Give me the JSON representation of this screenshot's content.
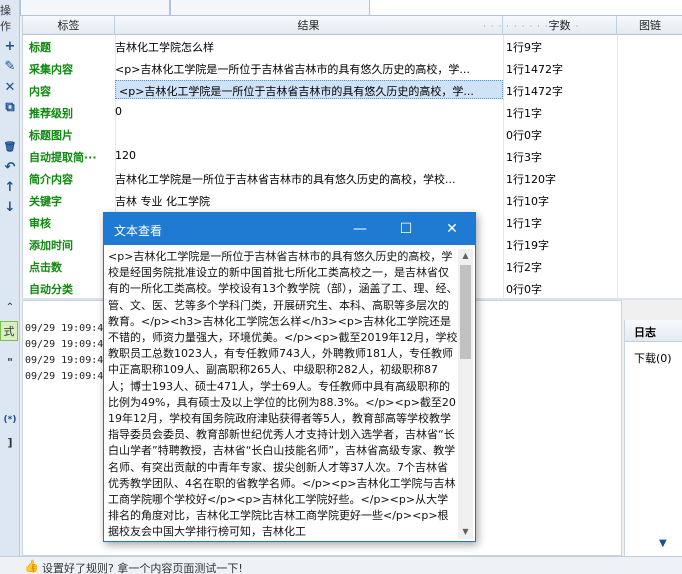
{
  "left_bar": {
    "label_top": "操作",
    "tools": [
      {
        "glyph": "+",
        "icon": "add-icon"
      },
      {
        "glyph": "✎",
        "icon": "edit-icon"
      },
      {
        "glyph": "✕",
        "icon": "delete-icon"
      },
      {
        "glyph": "⧉",
        "icon": "copy-icon"
      },
      {
        "glyph": "🗑",
        "icon": "trash-icon"
      },
      {
        "glyph": "↶",
        "icon": "undo-icon"
      },
      {
        "glyph": "↑",
        "icon": "move-up-icon"
      },
      {
        "glyph": "↓",
        "icon": "move-down-icon"
      }
    ],
    "collapse_glyph": "⌃",
    "tab_test": "式",
    "quote_glyph": "\"",
    "paren_glyph": "(*)",
    "bracket_glyph": "]"
  },
  "grid": {
    "columns": {
      "label": "标签",
      "result": "结果",
      "count": "字数",
      "link": "图链"
    },
    "more_glyph": "· · · · · · · · · · · · ·",
    "rows": [
      {
        "label": "标题",
        "result": "吉林化工学院怎么样",
        "count": "1行9字"
      },
      {
        "label": "采集内容",
        "result": "<p>吉林化工学院是一所位于吉林省吉林市的具有悠久历史的高校，学...",
        "count": "1行1472字"
      },
      {
        "label": "内容",
        "result": "<p>吉林化工学院是一所位于吉林省吉林市的具有悠久历史的高校，学...",
        "count": "1行1472字",
        "selected": true
      },
      {
        "label": "推荐级别",
        "result": "0",
        "count": "1行1字"
      },
      {
        "label": "标题图片",
        "result": "",
        "count": "0行0字"
      },
      {
        "label": "自动提取简···",
        "result": "120",
        "count": "1行3字"
      },
      {
        "label": "简介内容",
        "result": "吉林化工学院是一所位于吉林省吉林市的具有悠久历史的高校，学校...",
        "count": "1行120字"
      },
      {
        "label": "关键字",
        "result": "吉林  专业  化工学院",
        "count": "1行10字"
      },
      {
        "label": "审核",
        "result": "",
        "count": "1行1字"
      },
      {
        "label": "添加时间",
        "result": "",
        "count": "1行19字"
      },
      {
        "label": "点击数",
        "result": "",
        "count": "1行2字"
      },
      {
        "label": "自动分类",
        "result": "",
        "count": "0行0字"
      }
    ]
  },
  "log": {
    "lines": [
      "09/29 19:09:4",
      "09/29 19:09:4",
      "09/29 19:09:4",
      "09/29 19:09:4"
    ]
  },
  "right_panel": {
    "header": "日志",
    "item": "下载(0)",
    "arrow": "▼"
  },
  "status": {
    "text": "设置好了规则? 拿一个内容页面测试一下!"
  },
  "dialog": {
    "title": "文本查看",
    "minimize": "—",
    "maximize": "☐",
    "close": "✕",
    "text": "<p>吉林化工学院是一所位于吉林省吉林市的具有悠久历史的高校，学校是经国务院批准设立的新中国首批七所化工类高校之一，是吉林省仅有的一所化工类高校。学校设有13个教学院（部），涵盖了工、理、经、管、文、医、艺等多个学科门类，开展研究生、本科、高职等多层次的教育。</p><h3>吉林化工学院怎么样</h3><p>吉林化工学院还是不错的，师资力量强大，环境优美。</p><p>截至2019年12月，学校教职员工总数1023人，有专任教师743人，外聘教师181人，专任教师中正高职称109人、副高职称265人、中级职称282人，初级职称87人；博士193人、硕士471人，学士69人。专任教师中具有高级职称的比例为49%，具有硕士及以上学位的比例为88.3%。</p><p>截至2019年12月，学校有国务院政府津贴获得者等5人，教育部高等学校教学指导委员会委员、教育部新世纪优秀人才支持计划入选学者，吉林省“长白山学者”特聘教授，吉林省“长白山技能名师”，吉林省高级专家、教学名师、有突出贡献的中青年专家、拔尖创新人才等37人次。7个吉林省优秀教学团队、4名在职的省教学名师。</p><p>吉林化工学院与吉林工商学院哪个学校好</p><p>吉林化工学院好些。</p><p>从大学排名的角度对比，吉林化工学院比吉林工商学院更好一些</p><p>根据校友会中国大学排行榜可知，吉林化工"
  }
}
